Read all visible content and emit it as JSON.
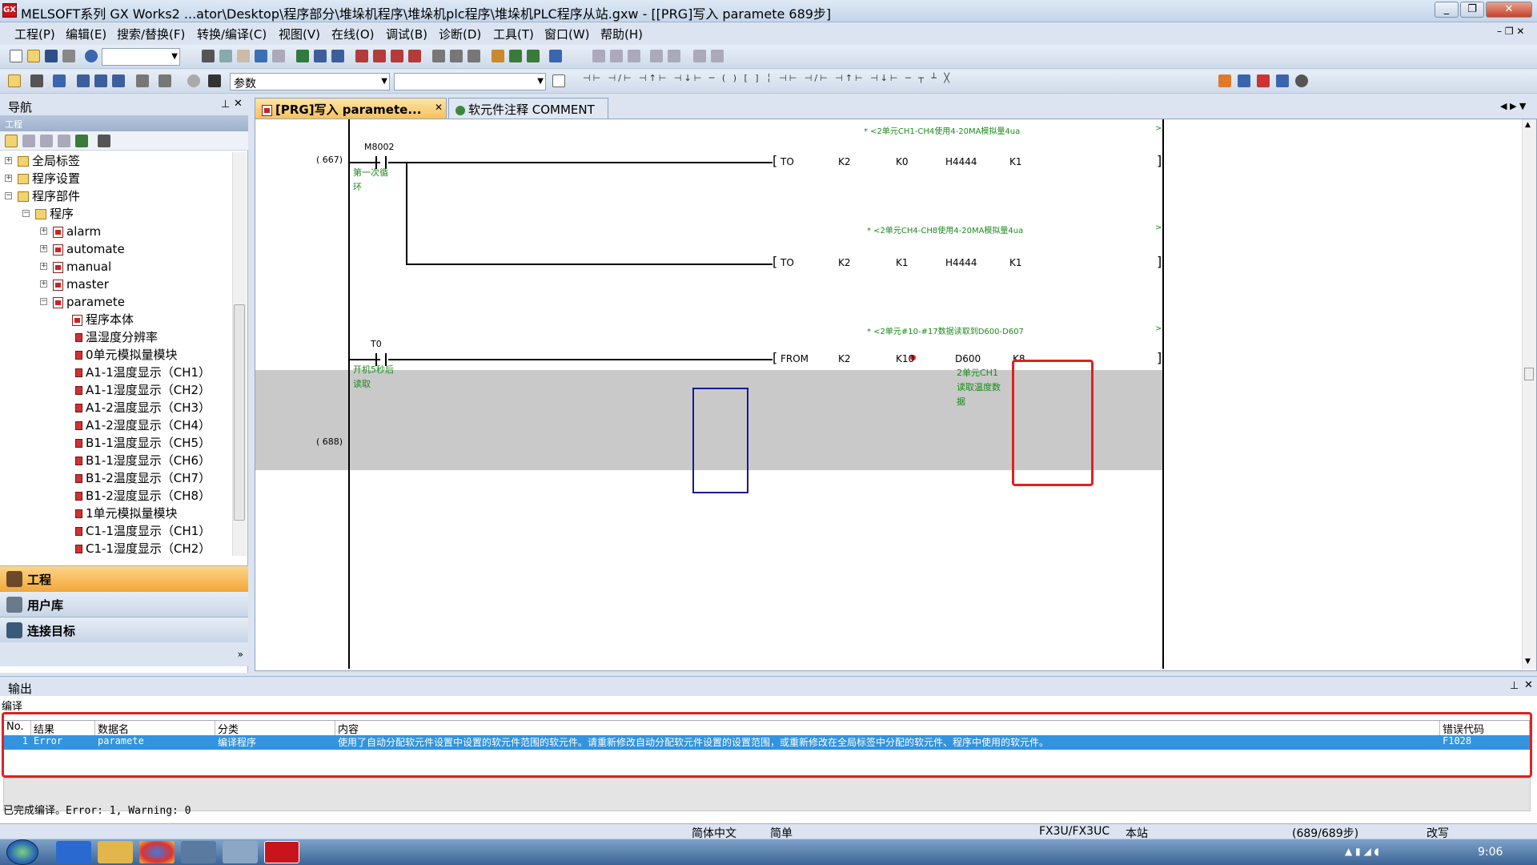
{
  "window": {
    "title": "MELSOFT系列 GX Works2 ...ator\\Desktop\\程序部分\\堆垛机程序\\堆垛机plc程序\\堆垛机PLC程序从站.gxw - [[PRG]写入 paramete 689步]",
    "icon_text": "GX"
  },
  "menu": {
    "items": [
      "工程(P)",
      "编辑(E)",
      "搜索/替换(F)",
      "转换/编译(C)",
      "视图(V)",
      "在线(O)",
      "调试(B)",
      "诊断(D)",
      "工具(T)",
      "窗口(W)",
      "帮助(H)"
    ]
  },
  "toolbar": {
    "param_select": "参数"
  },
  "nav": {
    "title": "导航",
    "subtitle": "工程",
    "tree": [
      {
        "label": "全局标签"
      },
      {
        "label": "程序设置"
      },
      {
        "label": "程序部件"
      },
      {
        "label": "程序"
      },
      {
        "label": "alarm"
      },
      {
        "label": "automate"
      },
      {
        "label": "manual"
      },
      {
        "label": "master"
      },
      {
        "label": "paramete"
      },
      {
        "label": "程序本体"
      },
      {
        "label": "温湿度分辨率"
      },
      {
        "label": "0单元模拟量模块"
      },
      {
        "label": "A1-1温度显示（CH1）"
      },
      {
        "label": "A1-1湿度显示（CH2）"
      },
      {
        "label": "A1-2温度显示（CH3）"
      },
      {
        "label": "A1-2湿度显示（CH4）"
      },
      {
        "label": "B1-1温度显示（CH5）"
      },
      {
        "label": "B1-1湿度显示（CH6）"
      },
      {
        "label": "B1-2温度显示（CH7）"
      },
      {
        "label": "B1-2湿度显示（CH8）"
      },
      {
        "label": "1单元模拟量模块"
      },
      {
        "label": "C1-1温度显示（CH1）"
      },
      {
        "label": "C1-1湿度显示（CH2）"
      }
    ],
    "buttons": [
      "工程",
      "用户库",
      "连接目标"
    ]
  },
  "tabs": [
    {
      "label": "[PRG]写入 paramete..."
    },
    {
      "label": "软元件注释 COMMENT"
    }
  ],
  "ladder": {
    "steps": [
      "( 667)",
      "( 688)"
    ],
    "rung1": {
      "contact": "M8002",
      "contact_note": "第一次循环",
      "comment_a": "* <2单元CH1-CH4使用4-20MA模拟量4ua",
      "comment_b": "* <2单元CH4-CH8使用4-20MA模拟量4ua",
      "arrow": ">",
      "instr_a": [
        "TO",
        "K2",
        "K0",
        "H4444",
        "K1"
      ],
      "instr_b": [
        "TO",
        "K2",
        "K1",
        "H4444",
        "K1"
      ]
    },
    "rung2": {
      "contact": "T0",
      "contact_note": "开机5秒后读取",
      "comment": "* <2单元#10-#17数据读取到D600-D607",
      "instr": [
        "FROM",
        "K2",
        "K10",
        "D600",
        "K8"
      ],
      "d600_note": "2单元CH1读取温度数据"
    },
    "brackets": {
      "open": "[",
      "close": "]"
    }
  },
  "output": {
    "title": "输出",
    "section": "编译",
    "headers": [
      "No.",
      "结果",
      "数据名",
      "分类",
      "内容",
      "错误代码"
    ],
    "row": {
      "no": "1",
      "result": "Error",
      "data": "paramete",
      "category": "编译程序",
      "content": "使用了自动分配软元件设置中设置的软元件范围的软元件。请重新修改自动分配软元件设置的设置范围，或重新修改在全局标签中分配的软元件、程序中使用的软元件。",
      "code": "F1028"
    },
    "status": "已完成编译。Error: 1, Warning: 0"
  },
  "statusbar": {
    "lang": "简体中文",
    "mode": "简单",
    "plc": "FX3U/FX3UC",
    "station": "本站",
    "steps": "(689/689步)",
    "edit": "改写"
  },
  "taskbar": {
    "time": "9:06"
  },
  "colors": {
    "highlight_red": "#e02020",
    "selection_blue": "#3393df",
    "comment_green": "#1b8a1b"
  }
}
